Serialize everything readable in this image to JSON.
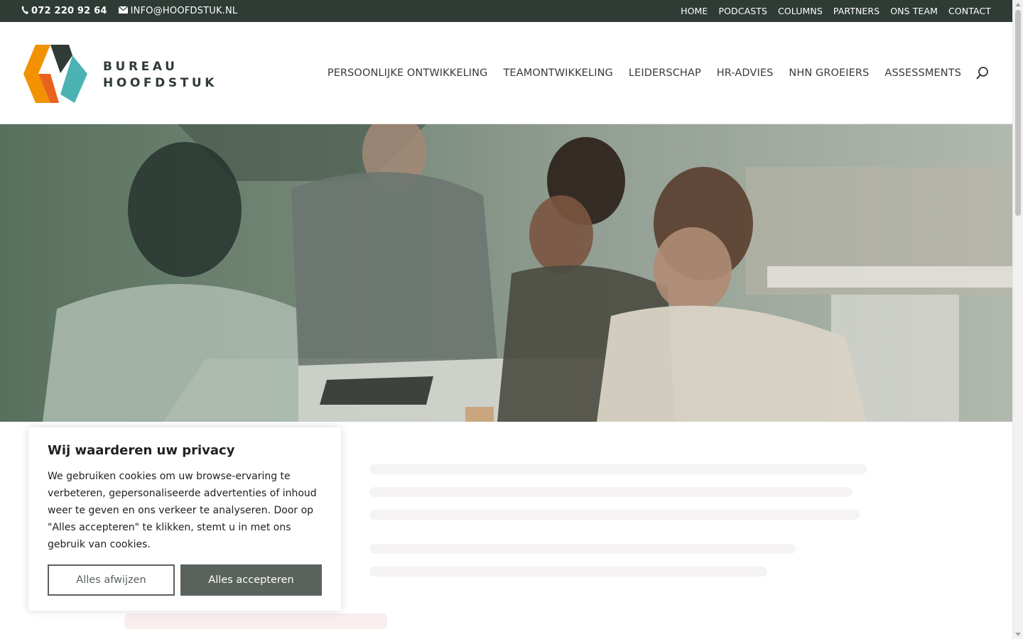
{
  "topbar": {
    "phone": "072 220 92 64",
    "email": "INFO@HOOFDSTUK.NL",
    "nav": [
      "HOME",
      "PODCASTS",
      "COLUMNS",
      "PARTNERS",
      "ONS TEAM",
      "CONTACT"
    ]
  },
  "header": {
    "logo_line1": "BUREAU",
    "logo_line2": "HOOFDSTUK",
    "nav": [
      "PERSOONLIJKE ONTWIKKELING",
      "TEAMONTWIKKELING",
      "LEIDERSCHAP",
      "HR-ADVIES",
      "NHN GROEIERS",
      "ASSESSMENTS"
    ],
    "search_icon": "search-icon"
  },
  "colors": {
    "topbar_bg": "#2f3b35",
    "logo_orange": "#f39200",
    "logo_orange_dark": "#e8621d",
    "logo_dark": "#2f3b35",
    "logo_teal": "#4bb3b4",
    "button_dark": "#5a625c"
  },
  "cookie": {
    "title": "Wij waarderen uw privacy",
    "text": "We gebruiken cookies om uw browse-ervaring te verbeteren, gepersonaliseerde advertenties of inhoud weer te geven en ons verkeer te analyseren. Door op \"Alles accepteren\" te klikken, stemt u in met ons gebruik van cookies.",
    "reject_label": "Alles afwijzen",
    "accept_label": "Alles accepteren"
  }
}
